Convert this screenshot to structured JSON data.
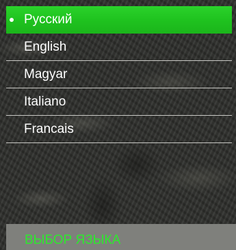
{
  "menu": {
    "items": [
      {
        "label": "Русский",
        "selected": true
      },
      {
        "label": "English",
        "selected": false
      },
      {
        "label": "Magyar",
        "selected": false
      },
      {
        "label": "Italiano",
        "selected": false
      },
      {
        "label": "Francais",
        "selected": false
      }
    ]
  },
  "footer": {
    "title": "ВЫБОР ЯЗЫКА"
  },
  "colors": {
    "selected_bg": "#1fc31f",
    "footer_bg": "#7f807c",
    "footer_text": "#2ee82e",
    "menu_text": "#ffffff",
    "divider": "#c8c8c4"
  }
}
